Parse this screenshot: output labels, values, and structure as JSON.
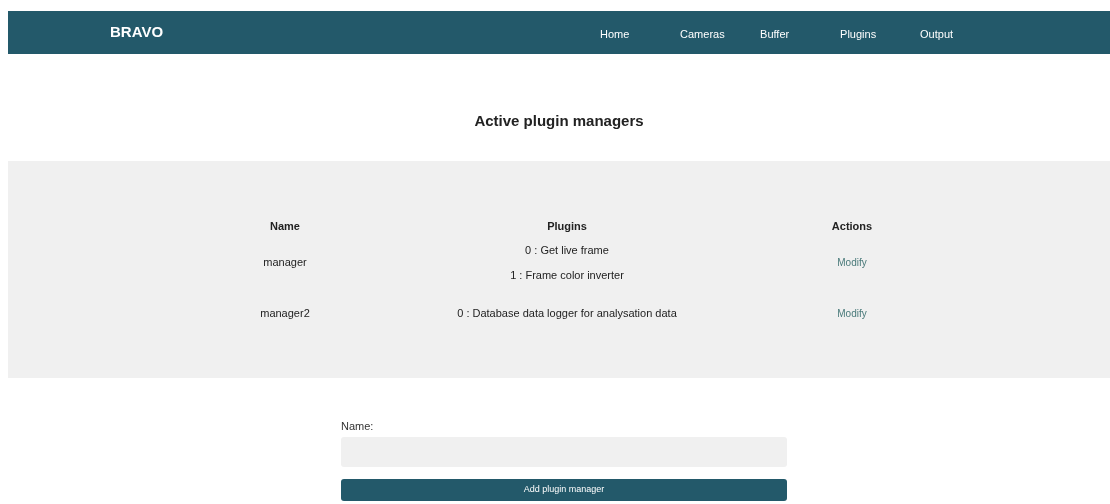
{
  "navbar": {
    "brand": "BRAVO",
    "links": [
      "Home",
      "Cameras",
      "Buffer",
      "Plugins",
      "Output"
    ]
  },
  "heading": "Active plugin managers",
  "table": {
    "columns": [
      "Name",
      "Plugins",
      "Actions"
    ],
    "rows": [
      {
        "name": "manager",
        "plugins": [
          "0 : Get live frame",
          "1 : Frame color inverter"
        ],
        "action": "Modify"
      },
      {
        "name": "manager2",
        "plugins": [
          "0 : Database data logger for analysation data"
        ],
        "action": "Modify"
      }
    ]
  },
  "form": {
    "label": "Name:",
    "button": "Add plugin manager"
  }
}
